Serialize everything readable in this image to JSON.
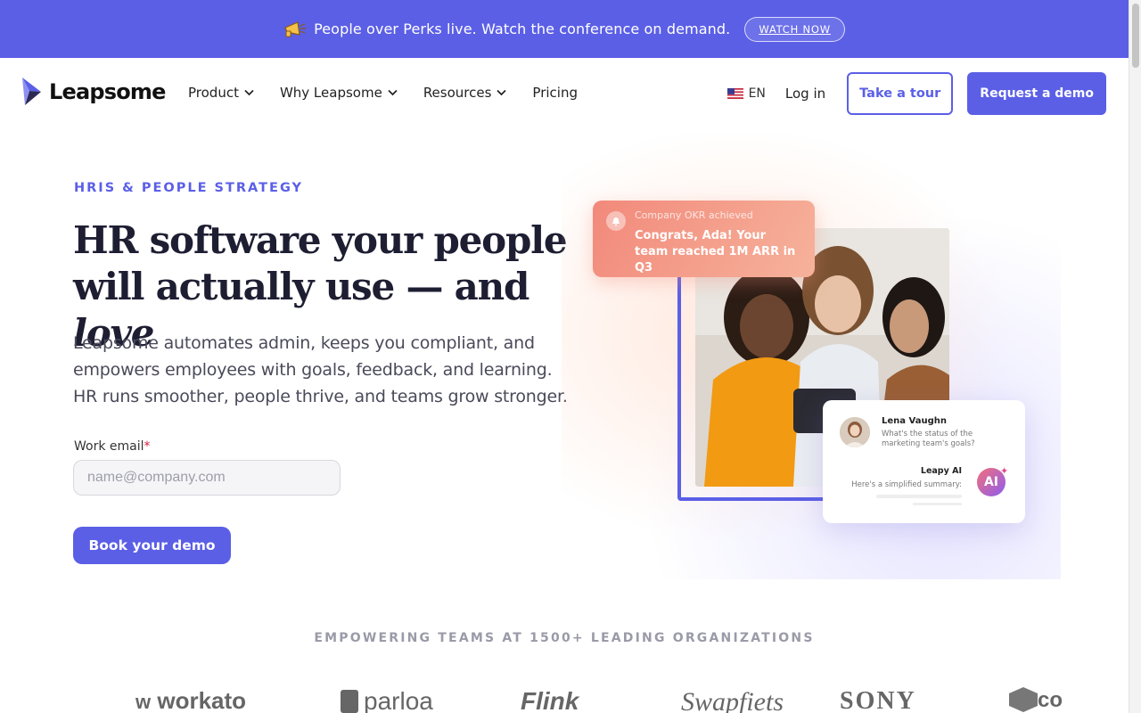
{
  "announcement": {
    "message": "People over Perks live. Watch the conference on demand.",
    "cta": "WATCH NOW"
  },
  "brand": {
    "name": "Leapsome",
    "accent": "#5b5fe6"
  },
  "nav": {
    "items": [
      {
        "label": "Product",
        "dropdown": true
      },
      {
        "label": "Why Leapsome",
        "dropdown": true
      },
      {
        "label": "Resources",
        "dropdown": true
      },
      {
        "label": "Pricing",
        "dropdown": false
      }
    ],
    "language": "EN",
    "login": "Log in",
    "tour": "Take a tour",
    "demo": "Request a demo"
  },
  "hero": {
    "eyebrow": "HRIS & PEOPLE STRATEGY",
    "headline_line1": "HR software your people",
    "headline_line2_prefix": "will actually use — and ",
    "headline_love": "love",
    "subtitle": "Leapsome automates admin, keeps you compliant, and empowers employees with goals, feedback, and learning. HR runs smoother, people thrive, and teams grow stronger.",
    "email_label": "Work email",
    "email_required": "*",
    "email_placeholder": "name@company.com",
    "email_value": "",
    "cta": "Book your demo"
  },
  "visual": {
    "okr_small": "Company OKR achieved",
    "okr_big": "Congrats, Ada! Your team reached 1M ARR in Q3",
    "chat_name": "Lena Vaughn",
    "chat_question": "What's the status of the marketing team's goals?",
    "ai_name": "Leapy AI",
    "ai_message": "Here's a simplified summary:",
    "ai_badge": "AI"
  },
  "logos": {
    "heading": "EMPOWERING TEAMS AT 1500+ LEADING ORGANIZATIONS",
    "items": [
      "workato",
      "parloa",
      "Flink",
      "Swapfiets",
      "SONY",
      "co"
    ]
  }
}
